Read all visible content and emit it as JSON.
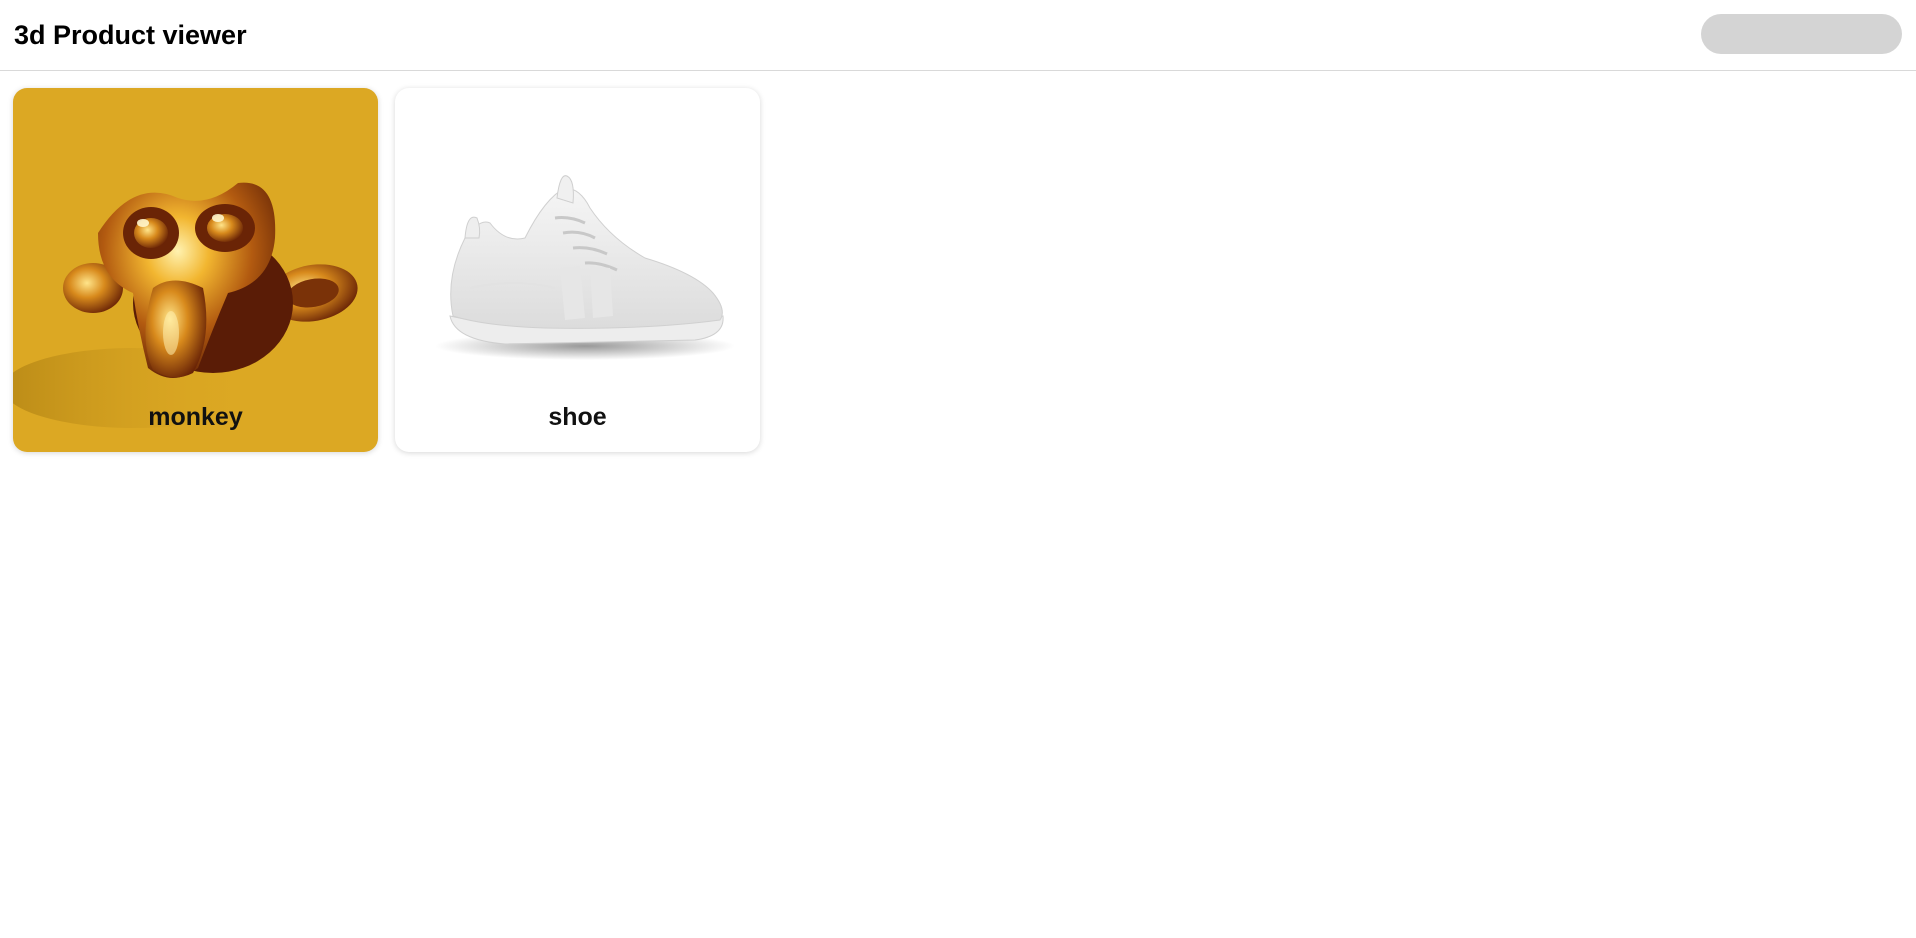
{
  "header": {
    "title": "3d Product viewer"
  },
  "products": [
    {
      "name": "monkey",
      "background": "#dca823",
      "icon": "monkey-head-icon"
    },
    {
      "name": "shoe",
      "background": "#ffffff",
      "icon": "sneaker-icon"
    }
  ]
}
